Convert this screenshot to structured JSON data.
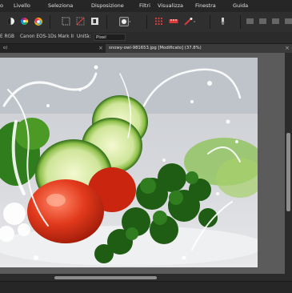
{
  "menubar": {
    "items": [
      {
        "label": "o"
      },
      {
        "label": "Livello"
      },
      {
        "label": "Seleziona"
      },
      {
        "label": "Disposizione"
      },
      {
        "label": "Filtri"
      },
      {
        "label": "Visualizza"
      },
      {
        "label": "Finestra"
      },
      {
        "label": "Guida"
      }
    ]
  },
  "toolbar": {
    "icons": [
      "half-circle-icon",
      "color-wheel-icon",
      "hsl-circles-icon",
      "marquee-icon",
      "no-selection-icon",
      "invert-selection-icon",
      "mask-icon",
      "grid-icon",
      "tape-icon",
      "magic-icon",
      "brush-icon"
    ]
  },
  "context": {
    "color_profile": "E RGB",
    "camera": "Canon EOS-1Ds Mark II",
    "units_label": "Unità:",
    "units_value": "Pixel"
  },
  "tabs": [
    {
      "label": "o)"
    },
    {
      "label": "snowy-owl-981653.jpg [Modificato] (37.8%)"
    }
  ],
  "colors": {
    "accent_red": "#d83a3a"
  }
}
